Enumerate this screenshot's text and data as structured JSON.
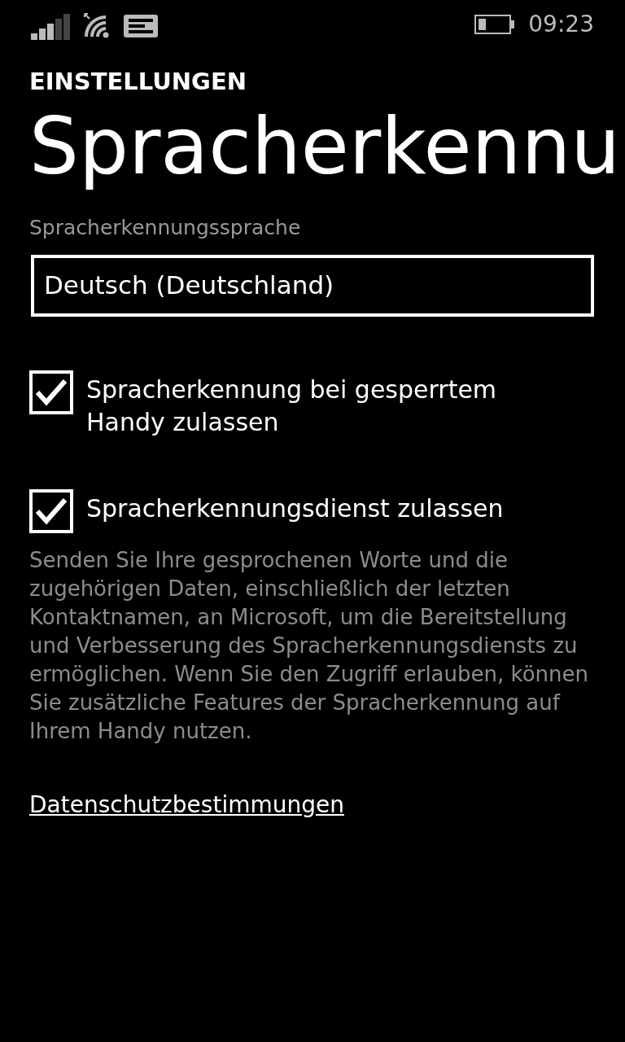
{
  "status_bar": {
    "time": "09:23"
  },
  "header": {
    "app": "EINSTELLUNGEN",
    "title": "Spracherkennu"
  },
  "language": {
    "label": "Spracherkennungssprache",
    "value": "Deutsch (Deutschland)"
  },
  "options": [
    {
      "label": "Spracherkennung bei gesperrtem Handy zulassen",
      "checked": true
    },
    {
      "label": "Spracherkennungsdienst zulassen",
      "checked": true
    }
  ],
  "description": "Senden Sie Ihre gesprochenen Worte und die zugehörigen Daten, einschließlich der letzten Kontaktnamen, an Microsoft, um die Bereitstellung und Verbesserung des Spracherkennungsdiensts zu ermöglichen. Wenn Sie den Zugriff erlauben, können Sie zusätzliche Features der Spracherkennung auf Ihrem Handy nutzen.",
  "privacy_link": "Datenschutzbestimmungen"
}
